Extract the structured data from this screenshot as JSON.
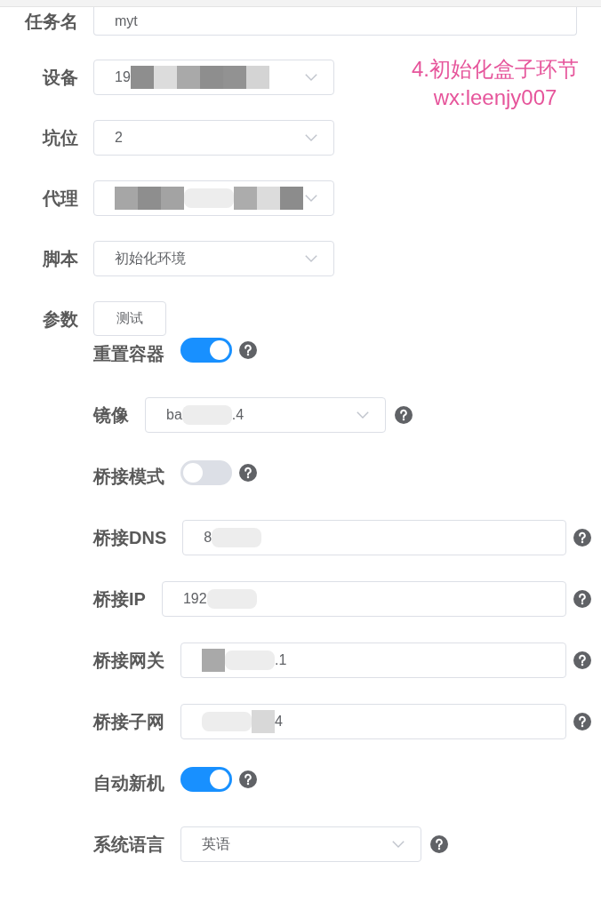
{
  "annotation": {
    "lines": [
      "4.初始化盒子环节",
      "wx:leenjy007"
    ]
  },
  "fields": [
    {
      "kind": "input",
      "label": "任务名",
      "value": [
        {
          "kind": "text",
          "text": "myt"
        }
      ]
    },
    {
      "kind": "select",
      "label": "设备",
      "value": [
        {
          "kind": "text",
          "text": "19"
        },
        {
          "kind": "tile",
          "color": "#8e8e8e"
        },
        {
          "kind": "tile",
          "color": "#dcdcdc"
        },
        {
          "kind": "tile",
          "color": "#a9a9a9"
        },
        {
          "kind": "tile",
          "color": "#8e8e8e"
        },
        {
          "kind": "tile",
          "color": "#929292"
        },
        {
          "kind": "tile",
          "color": "#d4d4d4"
        }
      ]
    },
    {
      "kind": "select",
      "label": "坑位",
      "value": [
        {
          "kind": "text",
          "text": "2"
        }
      ]
    },
    {
      "kind": "select",
      "label": "代理",
      "value": [
        {
          "kind": "tile",
          "color": "#a6a6a6"
        },
        {
          "kind": "tile",
          "color": "#8e8e8e"
        },
        {
          "kind": "tile",
          "color": "#a3a3a3"
        },
        {
          "kind": "blur"
        },
        {
          "kind": "tile",
          "color": "#acacac"
        },
        {
          "kind": "tile",
          "color": "#dcdcdc"
        },
        {
          "kind": "tile",
          "color": "#8c8c8c"
        }
      ]
    },
    {
      "kind": "select",
      "label": "脚本",
      "value": [
        {
          "kind": "text",
          "text": "初始化环境"
        }
      ]
    },
    {
      "kind": "button",
      "label": "参数",
      "button": "测试"
    }
  ],
  "params": [
    {
      "kind": "switch",
      "label": "重置容器",
      "on": true,
      "help": true
    },
    {
      "kind": "select",
      "label": "镜像",
      "value": [
        {
          "kind": "text",
          "text": "ba"
        },
        {
          "kind": "blur"
        },
        {
          "kind": "text",
          "text": ".4"
        }
      ],
      "help": true
    },
    {
      "kind": "switch",
      "label": "桥接模式",
      "on": false,
      "help": true
    },
    {
      "kind": "input",
      "label": "桥接DNS",
      "value": [
        {
          "kind": "text",
          "text": "8"
        },
        {
          "kind": "blur"
        }
      ],
      "help": true
    },
    {
      "kind": "input",
      "label": "桥接IP",
      "value": [
        {
          "kind": "text",
          "text": "192"
        },
        {
          "kind": "blur"
        }
      ],
      "help": true
    },
    {
      "kind": "input",
      "label": "桥接网关",
      "value": [
        {
          "kind": "tile",
          "color": "#a9a9a9"
        },
        {
          "kind": "blur"
        },
        {
          "kind": "text",
          "text": ".1"
        }
      ],
      "help": true
    },
    {
      "kind": "input",
      "label": "桥接子网",
      "value": [
        {
          "kind": "blur"
        },
        {
          "kind": "tile",
          "color": "#d8d8d8"
        },
        {
          "kind": "text",
          "text": "4"
        }
      ],
      "help": true
    },
    {
      "kind": "switch",
      "label": "自动新机",
      "on": true,
      "help": true
    },
    {
      "kind": "select",
      "label": "系统语言",
      "value": [
        {
          "kind": "text",
          "text": "英语"
        }
      ],
      "help": true
    }
  ]
}
